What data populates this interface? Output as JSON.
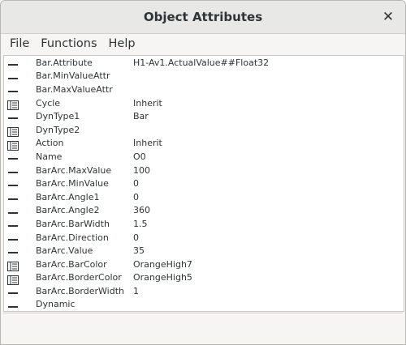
{
  "window": {
    "title": "Object Attributes",
    "close_label": "✕"
  },
  "menu": {
    "items": [
      "File",
      "Functions",
      "Help"
    ]
  },
  "attributes": [
    {
      "name": "Bar.Attribute",
      "value": "H1-Av1.ActualValue##Float32",
      "icon": "dash-icon"
    },
    {
      "name": "Bar.MinValueAttr",
      "value": "",
      "icon": "dash-icon"
    },
    {
      "name": "Bar.MaxValueAttr",
      "value": "",
      "icon": "dash-icon"
    },
    {
      "name": "Cycle",
      "value": "Inherit",
      "icon": "book-icon"
    },
    {
      "name": "DynType1",
      "value": "Bar",
      "icon": "dash-icon"
    },
    {
      "name": "DynType2",
      "value": "",
      "icon": "book-icon"
    },
    {
      "name": "Action",
      "value": "Inherit",
      "icon": "book-icon"
    },
    {
      "name": "Name",
      "value": "O0",
      "icon": "dash-icon"
    },
    {
      "name": "BarArc.MaxValue",
      "value": "100",
      "icon": "dash-icon"
    },
    {
      "name": "BarArc.MinValue",
      "value": "0",
      "icon": "dash-icon"
    },
    {
      "name": "BarArc.Angle1",
      "value": "0",
      "icon": "dash-icon"
    },
    {
      "name": "BarArc.Angle2",
      "value": "360",
      "icon": "dash-icon"
    },
    {
      "name": "BarArc.BarWidth",
      "value": "1.5",
      "icon": "dash-icon"
    },
    {
      "name": "BarArc.Direction",
      "value": "0",
      "icon": "dash-icon"
    },
    {
      "name": "BarArc.Value",
      "value": "35",
      "icon": "dash-icon"
    },
    {
      "name": "BarArc.BarColor",
      "value": "OrangeHigh7",
      "icon": "book-icon"
    },
    {
      "name": "BarArc.BorderColor",
      "value": "OrangeHigh5",
      "icon": "book-icon"
    },
    {
      "name": "BarArc.BorderWidth",
      "value": "1",
      "icon": "dash-icon"
    },
    {
      "name": "Dynamic",
      "value": "",
      "icon": "dash-icon"
    }
  ],
  "status": {
    "text": ""
  }
}
